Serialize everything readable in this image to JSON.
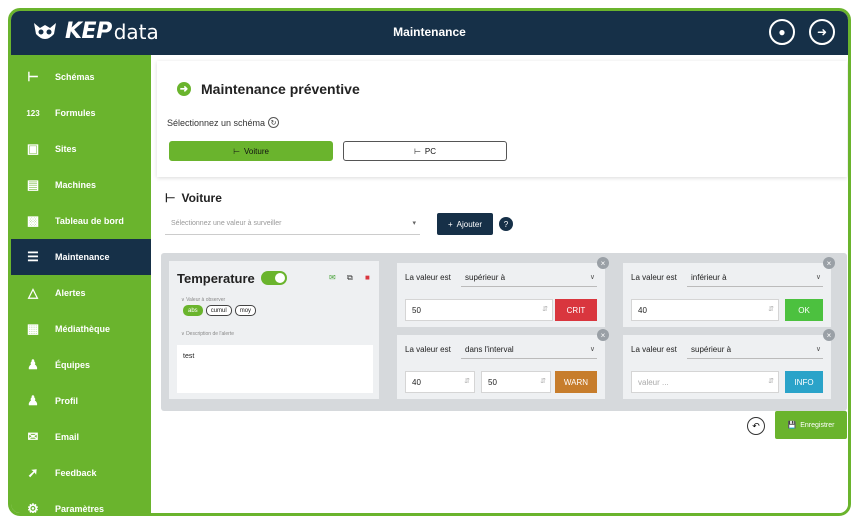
{
  "app": {
    "logo_main": "KEP",
    "logo_sub": "data",
    "page_title": "Maintenance"
  },
  "colors": {
    "brand_green": "#6ab42d",
    "navy": "#163048",
    "crit": "#d9363e",
    "ok": "#4cc13f",
    "warn": "#c77d2c",
    "info": "#2aa3c9"
  },
  "topbar_icons": [
    "notification-icon",
    "logout-icon"
  ],
  "sidebar": {
    "items": [
      {
        "label": "Schémas",
        "icon": "schema-icon"
      },
      {
        "label": "Formules",
        "icon": "123"
      },
      {
        "label": "Sites",
        "icon": "building-icon"
      },
      {
        "label": "Machines",
        "icon": "machine-icon"
      },
      {
        "label": "Tableau de bord",
        "icon": "dashboard-icon"
      },
      {
        "label": "Maintenance",
        "icon": "maintenance-icon",
        "active": true
      },
      {
        "label": "Alertes",
        "icon": "warning-icon"
      },
      {
        "label": "Médiathèque",
        "icon": "media-icon"
      },
      {
        "label": "Équipes",
        "icon": "team-icon"
      },
      {
        "label": "Profil",
        "icon": "user-icon"
      },
      {
        "label": "Email",
        "icon": "email-icon"
      },
      {
        "label": "Feedback",
        "icon": "feedback-icon"
      },
      {
        "label": "Paramètres",
        "icon": "gear-icon"
      }
    ]
  },
  "main": {
    "title": "Maintenance préventive",
    "select_schema_label": "Sélectionnez un schéma",
    "schemas": [
      {
        "label": "Voiture",
        "selected": true
      },
      {
        "label": "PC",
        "selected": false
      }
    ],
    "section_title": "Voiture",
    "value_select_placeholder": "Sélectionnez une valeur à surveiller",
    "add_button": "Ajouter"
  },
  "alert": {
    "name": "Temperature",
    "enabled": true,
    "value_label": "Valeur à observer",
    "chips": [
      {
        "label": "abs",
        "selected": true
      },
      {
        "label": "cumul",
        "selected": false
      },
      {
        "label": "moy",
        "selected": false
      }
    ],
    "desc_label": "Description de l'alerte",
    "description": "test",
    "conditions": [
      {
        "label": "La valeur est",
        "operator": "supérieur à",
        "value": "50",
        "level": "CRIT"
      },
      {
        "label": "La valeur est",
        "operator": "inférieur à",
        "value": "40",
        "level": "OK"
      },
      {
        "label": "La valeur est",
        "operator": "dans l'interval",
        "value": "40",
        "value2": "50",
        "level": "WARN"
      },
      {
        "label": "La valeur est",
        "operator": "supérieur à",
        "placeholder": "valeur ...",
        "level": "INFO"
      }
    ]
  },
  "save_button": "Enregistrer"
}
